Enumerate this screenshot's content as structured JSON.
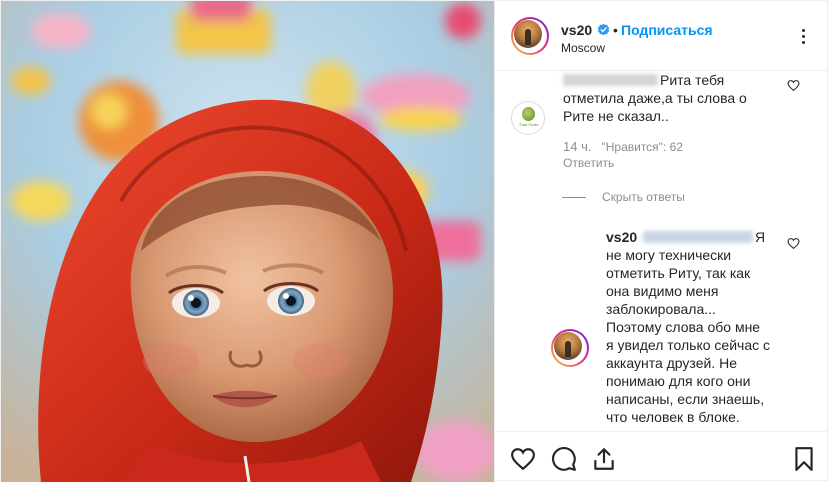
{
  "header": {
    "username": "vs20",
    "dot": "•",
    "follow_label": "Подписаться",
    "location": "Moscow"
  },
  "comment": {
    "text": "Рита тебя отметила даже,а ты слова о Рите не сказал..",
    "time": "14 ч.",
    "likes": "\"Нравится\": 62",
    "reply_label": "Ответить",
    "avatar_label": "Fast Fruits"
  },
  "hide_replies_label": "Скрыть ответы",
  "reply": {
    "username": "vs20",
    "text": "Я не могу технически отметить Риту, так как она видимо меня заблокировала... Поэтому слова обо мне я увидел только сейчас с аккаунта друзей. Не понимаю для кого они написаны, если знаешь, что человек в блоке."
  },
  "colors": {
    "accent": "#0095f6",
    "text": "#262626",
    "muted": "#8e8e8e",
    "hood": "#d8321e"
  },
  "icons": [
    "verified-badge-icon",
    "more-options-icon",
    "heart-icon",
    "comment-icon",
    "share-icon",
    "bookmark-icon"
  ]
}
